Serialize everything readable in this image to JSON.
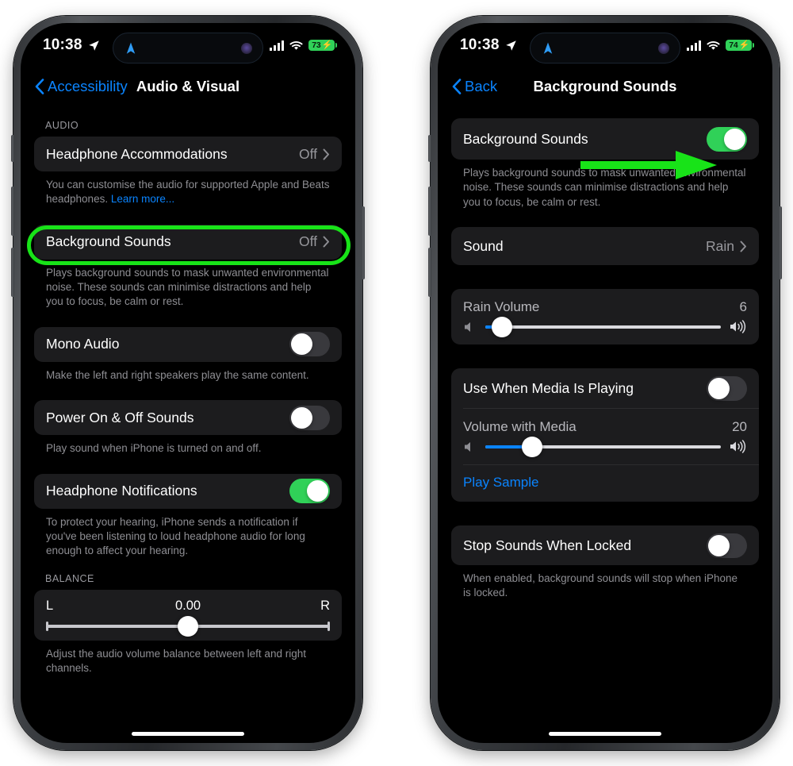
{
  "statusbar": {
    "time": "10:38",
    "location_icon": "location-arrow-icon",
    "island_nav_icon": "navigation-arrow-icon",
    "island_dot_icon": "camera-dot-icon",
    "cellular_icon": "cellular-bars-icon",
    "wifi_icon": "wifi-icon",
    "battery_left": "73",
    "battery_right": "74",
    "charging_icon": "lightning-bolt-icon"
  },
  "left_phone": {
    "nav": {
      "back_label": "Accessibility",
      "back_icon": "chevron-left-icon",
      "title": "Audio & Visual"
    },
    "section_audio_header": "AUDIO",
    "rows": {
      "headphone_accommodations": {
        "label": "Headphone Accommodations",
        "value": "Off",
        "chevron": "chevron-right-icon"
      },
      "headphone_accommodations_note": "You can customise the audio for supported Apple and Beats headphones. ",
      "headphone_accommodations_link": "Learn more...",
      "background_sounds": {
        "label": "Background Sounds",
        "value": "Off",
        "chevron": "chevron-right-icon"
      },
      "background_sounds_note": "Plays background sounds to mask unwanted environmental noise. These sounds can minimise distractions and help you to focus, be calm or rest.",
      "mono_audio": {
        "label": "Mono Audio",
        "state": "off"
      },
      "mono_audio_note": "Make the left and right speakers play the same content.",
      "power_sounds": {
        "label": "Power On & Off Sounds",
        "state": "off"
      },
      "power_sounds_note": "Play sound when iPhone is turned on and off.",
      "headphone_notifications": {
        "label": "Headphone Notifications",
        "state": "on"
      },
      "headphone_notifications_note": "To protect your hearing, iPhone sends a notification if you've been listening to loud headphone audio for long enough to affect your hearing."
    },
    "section_balance_header": "BALANCE",
    "balance": {
      "left_label": "L",
      "right_label": "R",
      "value": "0.00",
      "position_percent": 50,
      "note": "Adjust the audio volume balance between left and right channels."
    }
  },
  "right_phone": {
    "nav": {
      "back_label": "Back",
      "back_icon": "chevron-left-icon",
      "title": "Background Sounds"
    },
    "background_sounds_toggle": {
      "label": "Background Sounds",
      "state": "on"
    },
    "background_sounds_note": "Plays background sounds to mask unwanted environmental noise. These sounds can minimise distractions and help you to focus, be calm or rest.",
    "sound_row": {
      "label": "Sound",
      "value": "Rain",
      "chevron": "chevron-right-icon"
    },
    "rain_volume": {
      "label": "Rain Volume",
      "value": "6",
      "fill_percent": 7,
      "knob_percent": 7,
      "low_icon": "speaker-low-icon",
      "high_icon": "speaker-high-icon"
    },
    "use_when_media": {
      "label": "Use When Media Is Playing",
      "state": "off"
    },
    "volume_with_media": {
      "label": "Volume with Media",
      "value": "20",
      "fill_percent": 20,
      "knob_percent": 20,
      "low_icon": "speaker-low-icon",
      "high_icon": "speaker-high-icon"
    },
    "play_sample": "Play Sample",
    "stop_when_locked": {
      "label": "Stop Sounds When Locked",
      "state": "off"
    },
    "stop_when_locked_note": "When enabled, background sounds will stop when iPhone is locked."
  },
  "annotations": {
    "highlight_color": "#18e318",
    "arrow_color": "#18e318",
    "highlight_target": "background-sounds-row",
    "arrow_target": "background-sounds-toggle"
  },
  "colors": {
    "accent_blue": "#0a84ff",
    "toggle_on_green": "#30d158",
    "card_bg": "#1c1c1e",
    "screen_bg": "#000000",
    "secondary_text": "#8e8e93"
  }
}
